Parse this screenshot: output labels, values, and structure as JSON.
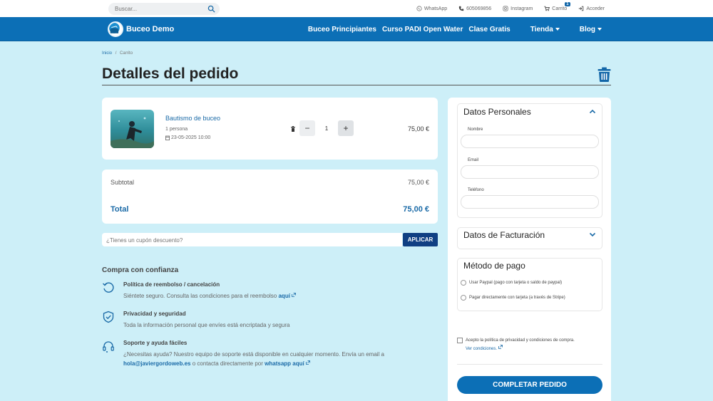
{
  "topbar": {
    "search_placeholder": "Buscar...",
    "links": {
      "whatsapp": "WhatsApp",
      "phone": "605069856",
      "instagram": "Instagram",
      "cart": "Carrito",
      "cart_count": "1",
      "login": "Acceder"
    }
  },
  "nav": {
    "brand": "Buceo Demo",
    "items": {
      "beginners": "Buceo Principiantes",
      "padi": "Curso PADI Open Water",
      "free_class": "Clase Gratis",
      "shop": "Tienda",
      "blog": "Blog"
    }
  },
  "breadcrumb": {
    "home": "Inicio",
    "sep": "/",
    "current": "Carrito"
  },
  "page_title": "Detalles del pedido",
  "cart_item": {
    "title": "Bautismo de buceo",
    "persons": "1 persona",
    "date": "23-05-2025 10:00",
    "quantity": "1",
    "minus": "−",
    "plus": "+",
    "price": "75,00 €"
  },
  "totals": {
    "subtotal_label": "Subtotal",
    "subtotal_value": "75,00 €",
    "total_label": "Total",
    "total_value": "75,00 €"
  },
  "coupon": {
    "placeholder": "¿Tienes un cupón descuento?",
    "apply_label": "APLICAR"
  },
  "trust": {
    "title": "Compra con confianza",
    "refund": {
      "title": "Política de reembolso / cancelación",
      "text": "Siéntete seguro. Consulta las condiciones para el reembolso",
      "link": "aquí"
    },
    "privacy": {
      "title": "Privacidad y seguridad",
      "text": "Toda la información personal que envíes está encriptada y segura"
    },
    "support": {
      "title": "Soporte y ayuda fáciles",
      "text1": "¿Necesitas ayuda? Nuestro equipo de soporte está disponible en cualquier momento. Envía un email a",
      "email": "hola@javiergordoweb.es",
      "text2": "o contacta directamente por",
      "whatsapp_link": "whatsapp aquí"
    }
  },
  "checkout": {
    "personal": {
      "title": "Datos Personales",
      "name_label": "Nombre",
      "email_label": "Email",
      "phone_label": "Teléfono"
    },
    "billing": {
      "title": "Datos de Facturación"
    },
    "payment": {
      "title": "Método de pago",
      "option_paypal": "Usar Paypal (pago con tarjeta o saldo de paypal)",
      "option_stripe": "Pagar directamente con tarjeta (a través de Stripe)"
    },
    "consent_text": "Acepto la política de privacidad y condiciones de compra.",
    "consent_link": "Ver condiciones.",
    "complete_label": "COMPLETAR PEDIDO"
  },
  "colors": {
    "background": "#cdeff8",
    "nav": "#0c6fb6",
    "accent": "#1a6aa7",
    "apply_button": "#103f83"
  }
}
